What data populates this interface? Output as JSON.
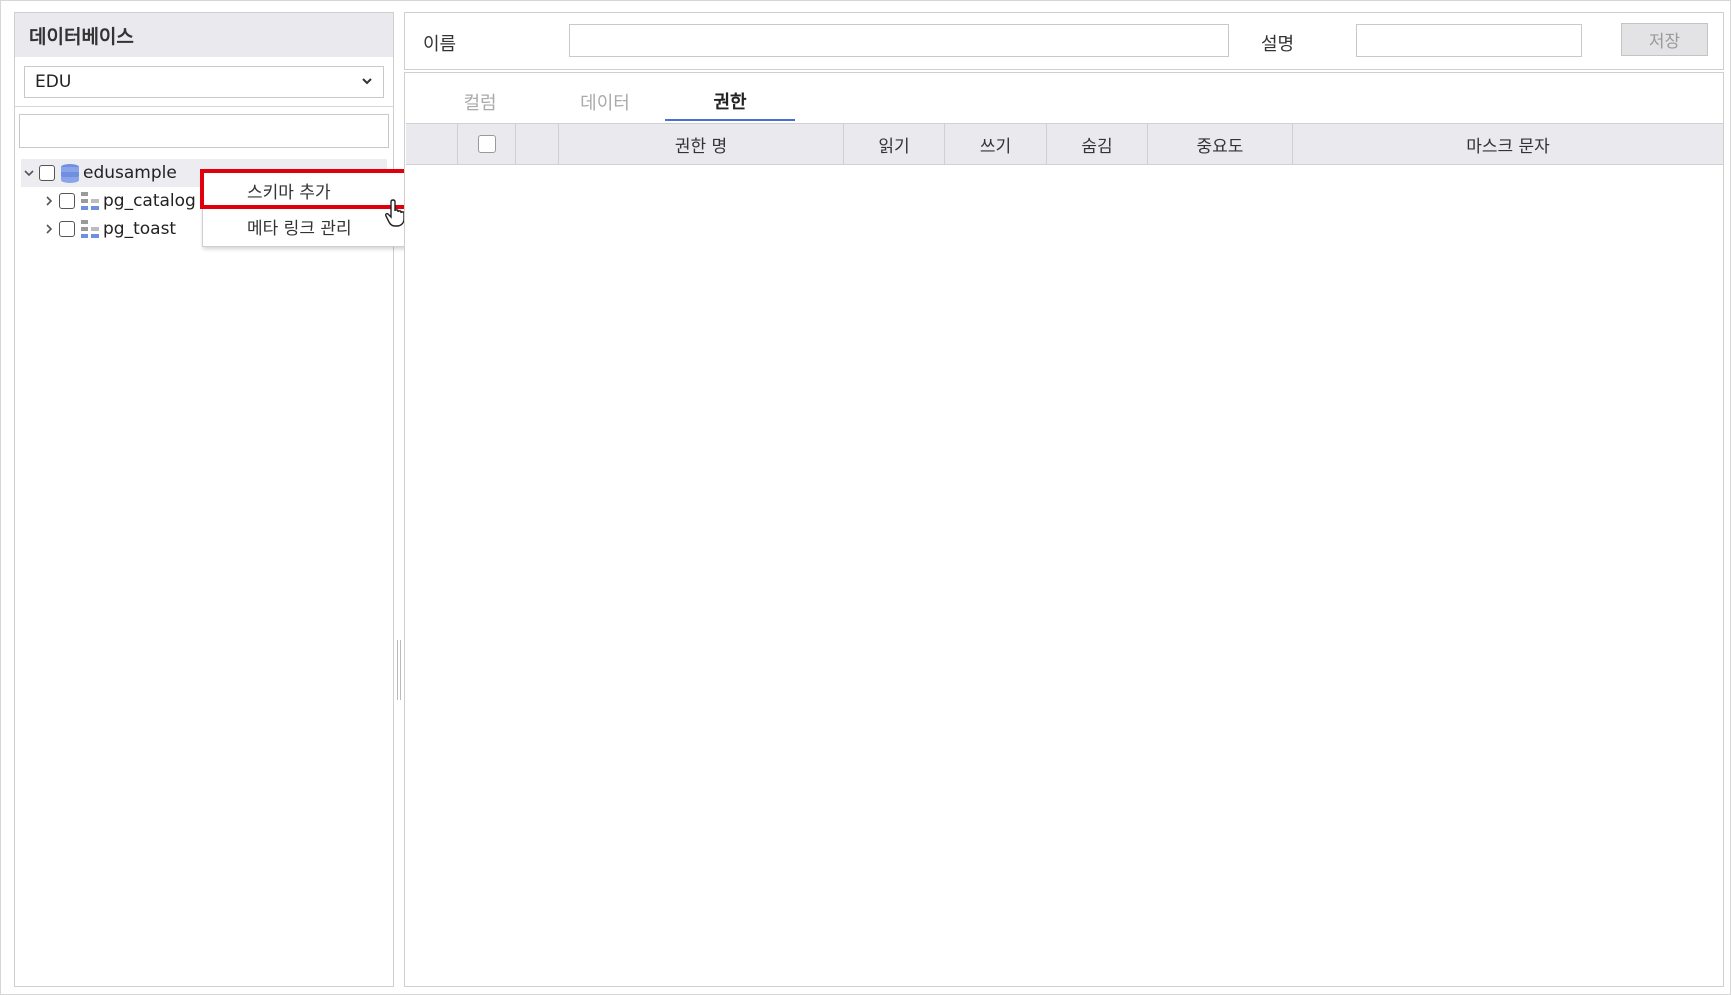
{
  "left_panel": {
    "title": "데이터베이스",
    "db_select": {
      "value": "EDU"
    },
    "search": {
      "value": "",
      "placeholder": ""
    },
    "tree": [
      {
        "label": "edusample",
        "icon": "database-icon",
        "expanded": true
      },
      {
        "label": "pg_catalog",
        "icon": "schema-icon"
      },
      {
        "label": "pg_toast",
        "icon": "schema-icon"
      }
    ]
  },
  "context_menu": {
    "items": [
      {
        "label": "스키마 추가"
      },
      {
        "label": "메타 링크 관리"
      }
    ],
    "highlight_color": "#e0000b"
  },
  "form": {
    "name_label": "이름",
    "name_value": "",
    "desc_label": "설명",
    "desc_value": "",
    "save_label": "저장"
  },
  "tabs": [
    {
      "label": "컬럼",
      "active": false
    },
    {
      "label": "데이터",
      "active": false
    },
    {
      "label": "권한",
      "active": true
    }
  ],
  "grid": {
    "columns": [
      "권한 명",
      "읽기",
      "쓰기",
      "숨김",
      "중요도",
      "마스크 문자"
    ]
  },
  "colors": {
    "accent": "#4a6fd6",
    "header_bg": "#e9e9ee",
    "db_icon": "#6f8fe0"
  }
}
